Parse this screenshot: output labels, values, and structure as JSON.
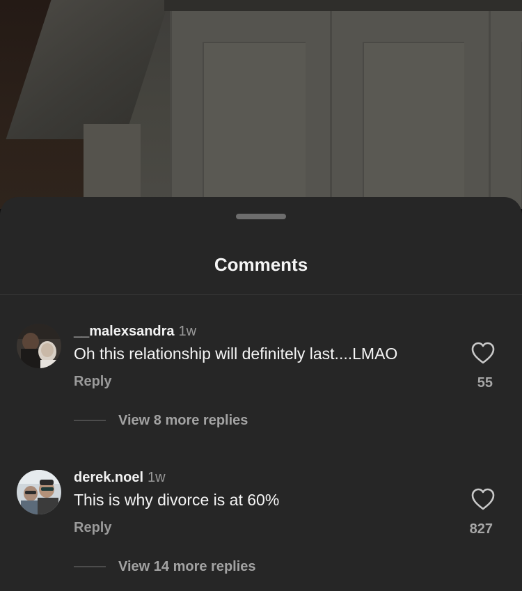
{
  "sheet": {
    "title": "Comments"
  },
  "comments": [
    {
      "username": "__malexsandra",
      "time": "1w",
      "text": "Oh this relationship will definitely last....LMAO",
      "reply_label": "Reply",
      "likes": "55",
      "view_replies_label": "View 8 more replies"
    },
    {
      "username": "derek.noel",
      "time": "1w",
      "text": "This is why divorce is at 60%",
      "reply_label": "Reply",
      "likes": "827",
      "view_replies_label": "View 14 more replies"
    }
  ],
  "colors": {
    "sheet_bg": "#262626",
    "primary_text": "#f5f5f5",
    "secondary_text": "#9b9b9b"
  },
  "icons": {
    "like": "heart-outline-icon",
    "grabber": "drag-handle"
  }
}
